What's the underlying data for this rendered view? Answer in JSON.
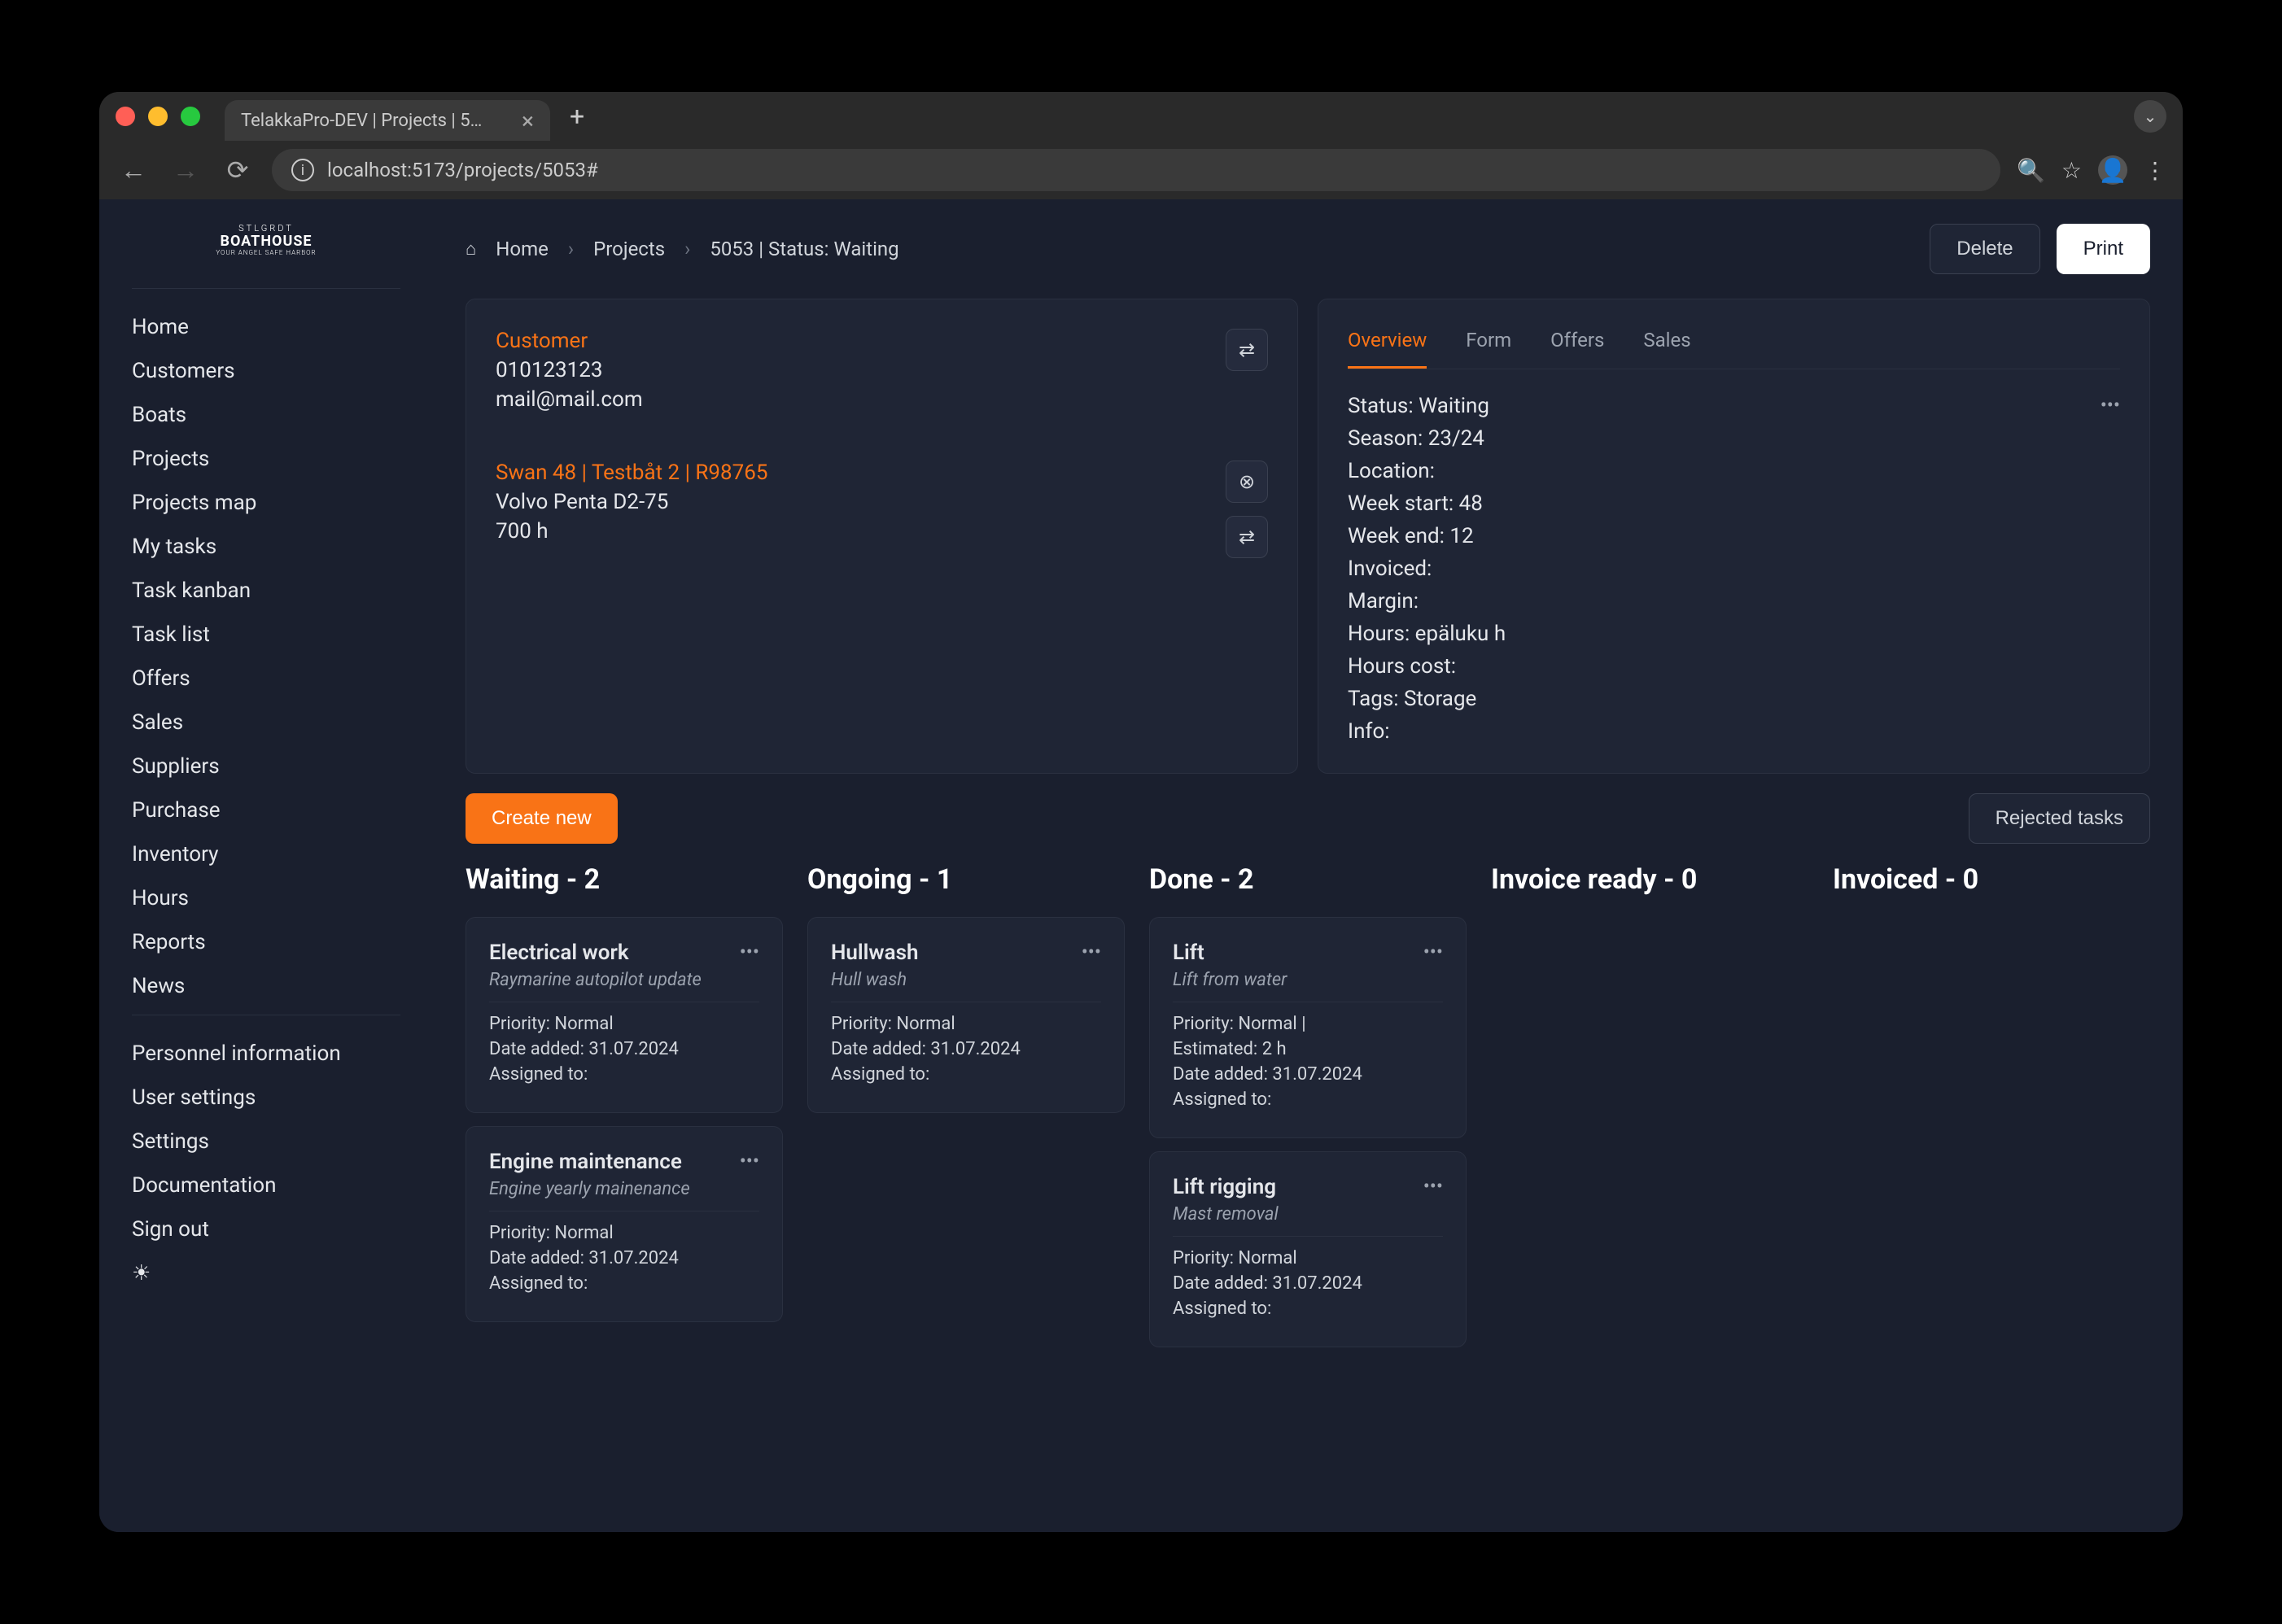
{
  "browser": {
    "tabTitle": "TelakkaPro-DEV | Projects | 5…",
    "url": "localhost:5173/projects/5053#"
  },
  "logo": "BOATHOUSE",
  "sidebar": {
    "group1": [
      "Home",
      "Customers",
      "Boats",
      "Projects",
      "Projects map",
      "My tasks",
      "Task kanban",
      "Task list",
      "Offers",
      "Sales",
      "Suppliers",
      "Purchase",
      "Inventory",
      "Hours",
      "Reports",
      "News"
    ],
    "group2": [
      "Personnel information",
      "User settings",
      "Settings",
      "Documentation",
      "Sign out"
    ]
  },
  "breadcrumb": {
    "home": "Home",
    "projects": "Projects",
    "current": "5053 | Status: Waiting"
  },
  "actions": {
    "delete": "Delete",
    "print": "Print"
  },
  "customer": {
    "label": "Customer",
    "phone": "010123123",
    "email": "mail@mail.com"
  },
  "boat": {
    "label": "Swan 48 | Testbåt 2 | R98765",
    "engine": "Volvo Penta D2-75",
    "hours": "700 h"
  },
  "tabs": [
    "Overview",
    "Form",
    "Offers",
    "Sales"
  ],
  "overview": {
    "status": "Status: Waiting",
    "season": "Season: 23/24",
    "location": "Location:",
    "weekStart": "Week start: 48",
    "weekEnd": "Week end: 12",
    "invoiced": "Invoiced:",
    "margin": "Margin:",
    "hours": "Hours: epäluku h",
    "hoursCost": "Hours cost:",
    "tags": "Tags: Storage",
    "info": "Info:"
  },
  "taskToolbar": {
    "createNew": "Create new",
    "rejected": "Rejected tasks"
  },
  "columns": [
    {
      "title": "Waiting - 2",
      "cards": [
        {
          "title": "Electrical work",
          "subtitle": "Raymarine autopilot update",
          "meta": [
            "Priority: Normal",
            "Date added: 31.07.2024",
            "Assigned to:"
          ]
        },
        {
          "title": "Engine maintenance",
          "subtitle": "Engine yearly mainenance",
          "meta": [
            "Priority: Normal",
            "Date added: 31.07.2024",
            "Assigned to:"
          ]
        }
      ]
    },
    {
      "title": "Ongoing - 1",
      "cards": [
        {
          "title": "Hullwash",
          "subtitle": "Hull wash",
          "meta": [
            "Priority: Normal",
            "Date added: 31.07.2024",
            "Assigned to:"
          ]
        }
      ]
    },
    {
      "title": "Done - 2",
      "cards": [
        {
          "title": "Lift",
          "subtitle": "Lift from water",
          "meta": [
            "Priority: Normal |",
            "Estimated: 2 h",
            "Date added: 31.07.2024",
            "Assigned to:"
          ]
        },
        {
          "title": "Lift rigging",
          "subtitle": "Mast removal",
          "meta": [
            "Priority: Normal",
            "Date added: 31.07.2024",
            "Assigned to:"
          ]
        }
      ]
    },
    {
      "title": "Invoice ready - 0",
      "cards": []
    },
    {
      "title": "Invoiced - 0",
      "cards": []
    }
  ]
}
